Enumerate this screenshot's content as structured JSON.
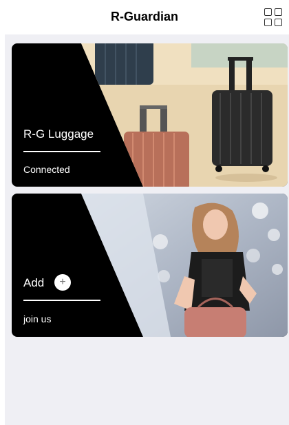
{
  "header": {
    "title": "R-Guardian",
    "menu_icon": "grid-icon"
  },
  "cards": [
    {
      "label": "R-G Luggage",
      "status": "Connected",
      "image": "luggage-photo"
    },
    {
      "label": "Add",
      "action_icon": "plus-icon",
      "action_glyph": "+",
      "status": "join us",
      "image": "girl-with-bag-photo"
    }
  ],
  "colors": {
    "card_background": "#000000",
    "page_background": "#efeff4",
    "text_on_card": "#ffffff"
  }
}
